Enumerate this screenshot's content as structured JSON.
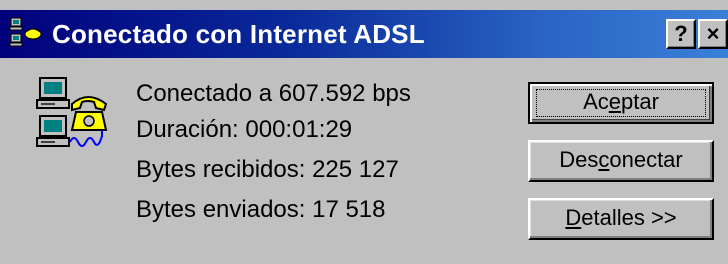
{
  "window": {
    "title": "Conectado con Internet ADSL",
    "help_label": "?",
    "close_label": "×"
  },
  "info": {
    "speed": "Conectado a 607.592 bps",
    "duration": "Duración:  000:01:29",
    "bytes_received": "Bytes recibidos:  225 127",
    "bytes_sent": "Bytes enviados:  17 518"
  },
  "buttons": {
    "accept": {
      "before": "Ac",
      "mnemonic": "e",
      "after": "ptar"
    },
    "disconnect": {
      "before": "Des",
      "mnemonic": "c",
      "after": "onectar"
    },
    "details": {
      "before": "",
      "mnemonic": "D",
      "after": "etalles >>"
    }
  },
  "colors": {
    "titlebar_start": "#00007b",
    "titlebar_end": "#3a80d8",
    "face": "#c0c0c0"
  },
  "icons": {
    "title": "dialup-network-icon",
    "connection": "connected-computers-phone-icon"
  }
}
